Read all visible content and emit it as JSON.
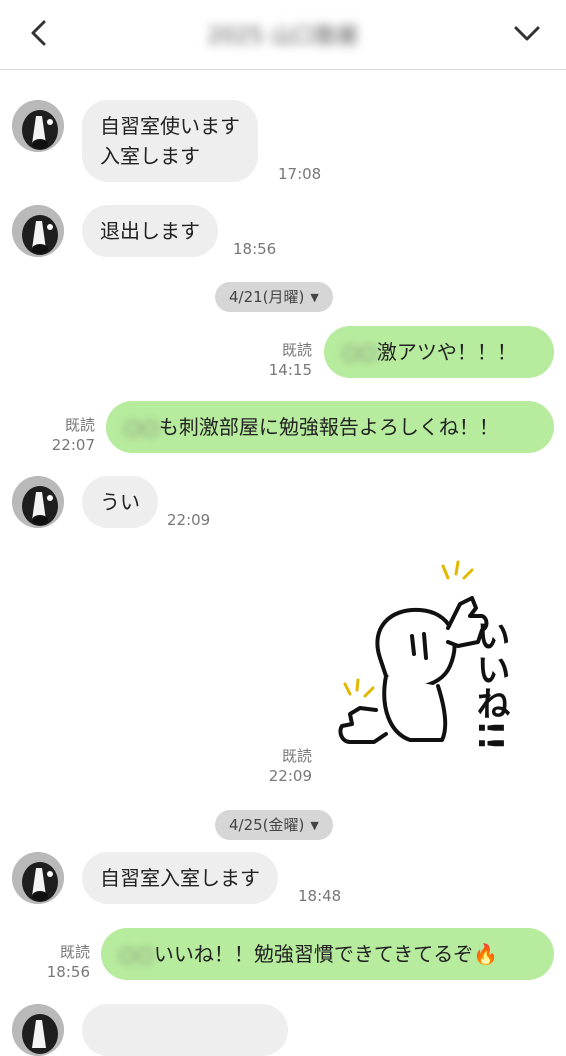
{
  "header": {
    "title": "2025 山口塾屋",
    "back_icon": "chevron-left-icon",
    "menu_icon": "chevron-down-icon"
  },
  "colors": {
    "outgoing_bubble": "#b7eb9d",
    "incoming_bubble": "#eeeeef",
    "date_pill": "#d6d6d6"
  },
  "messages": {
    "m1": {
      "line1": "自習室使います",
      "line2": "入室します",
      "time": "17:08"
    },
    "m2": {
      "text": "退出します",
      "time": "18:56"
    },
    "date1": "4/21(月曜)",
    "m3": {
      "blurred": "○○",
      "text": "激アツや！！！",
      "read": "既読",
      "time": "14:15"
    },
    "m4": {
      "blurred": "○○",
      "text": "も刺激部屋に勉強報告よろしくね！！",
      "read": "既読",
      "time": "22:07"
    },
    "m5": {
      "text": "うい",
      "time": "22:09"
    },
    "m6": {
      "sticker_text": "いいね!!",
      "read": "既読",
      "time": "22:09"
    },
    "date2": "4/25(金曜)",
    "m7": {
      "text": "自習室入室します",
      "time": "18:48"
    },
    "m8": {
      "blurred": "○○",
      "text": "いいね！！勉強習慣できてきてるぞ🔥",
      "read": "既読",
      "time": "18:56"
    }
  }
}
